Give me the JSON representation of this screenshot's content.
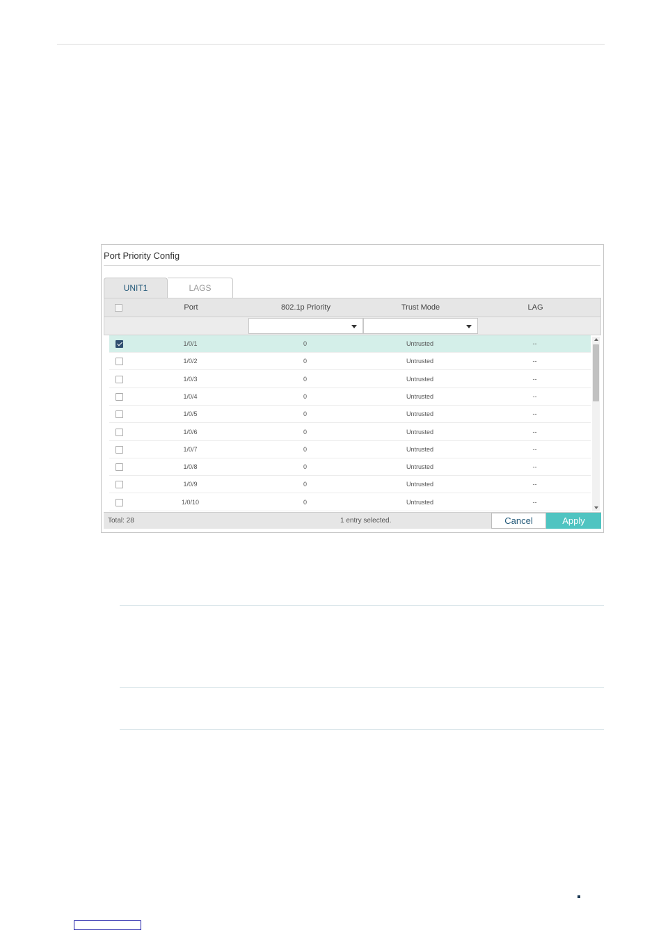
{
  "panel": {
    "title": "Port Priority Config",
    "tabs": [
      {
        "label": "UNIT1",
        "active": true
      },
      {
        "label": "LAGS",
        "active": false
      }
    ]
  },
  "table": {
    "columns": [
      "Port",
      "802.1p Priority",
      "Trust Mode",
      "LAG"
    ],
    "filters": {
      "priority": "",
      "trust_mode": ""
    },
    "rows": [
      {
        "port": "1/0/1",
        "priority": "0",
        "trust": "Untrusted",
        "lag": "--",
        "checked": true
      },
      {
        "port": "1/0/2",
        "priority": "0",
        "trust": "Untrusted",
        "lag": "--",
        "checked": false
      },
      {
        "port": "1/0/3",
        "priority": "0",
        "trust": "Untrusted",
        "lag": "--",
        "checked": false
      },
      {
        "port": "1/0/4",
        "priority": "0",
        "trust": "Untrusted",
        "lag": "--",
        "checked": false
      },
      {
        "port": "1/0/5",
        "priority": "0",
        "trust": "Untrusted",
        "lag": "--",
        "checked": false
      },
      {
        "port": "1/0/6",
        "priority": "0",
        "trust": "Untrusted",
        "lag": "--",
        "checked": false
      },
      {
        "port": "1/0/7",
        "priority": "0",
        "trust": "Untrusted",
        "lag": "--",
        "checked": false
      },
      {
        "port": "1/0/8",
        "priority": "0",
        "trust": "Untrusted",
        "lag": "--",
        "checked": false
      },
      {
        "port": "1/0/9",
        "priority": "0",
        "trust": "Untrusted",
        "lag": "--",
        "checked": false
      },
      {
        "port": "1/0/10",
        "priority": "0",
        "trust": "Untrusted",
        "lag": "--",
        "checked": false
      }
    ]
  },
  "footer": {
    "total": "Total: 28",
    "selected": "1 entry selected.",
    "cancel_label": "Cancel",
    "apply_label": "Apply"
  },
  "colors": {
    "accent": "#4fc4c1",
    "selected_row": "#d4efe9",
    "header_bg": "#e6e6e6"
  }
}
